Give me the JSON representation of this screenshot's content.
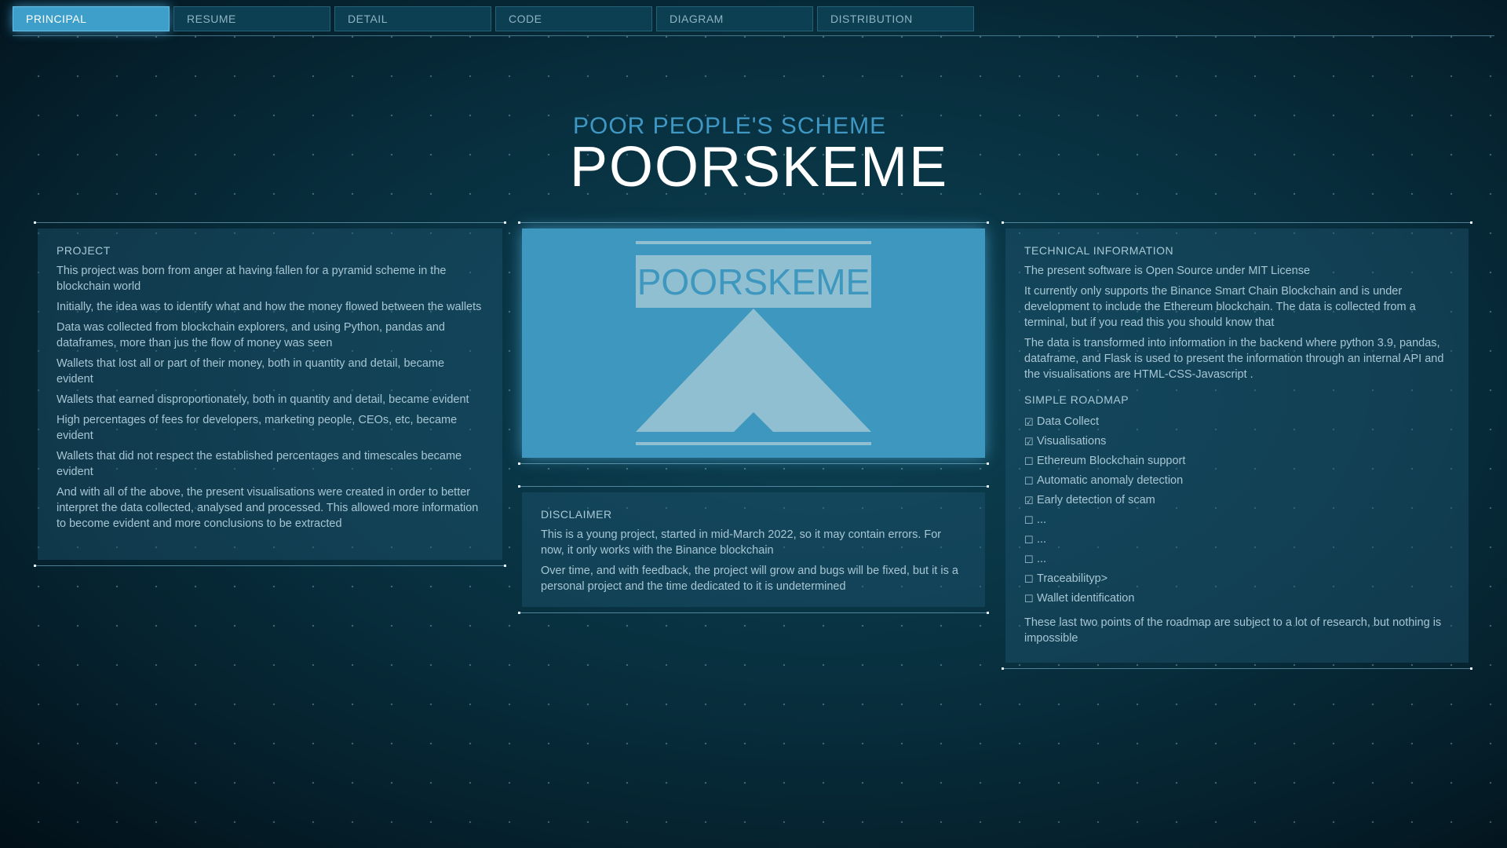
{
  "tabs": [
    {
      "label": "PRINCIPAL",
      "active": true
    },
    {
      "label": "RESUME",
      "active": false
    },
    {
      "label": "DETAIL",
      "active": false
    },
    {
      "label": "CODE",
      "active": false
    },
    {
      "label": "DIAGRAM",
      "active": false
    },
    {
      "label": "DISTRIBUTION",
      "active": false
    }
  ],
  "header": {
    "subtitle": "POOR PEOPLE'S SCHEME",
    "title": "POORSKEME"
  },
  "project": {
    "title": "PROJECT",
    "paragraphs": [
      "This project was born from anger at having fallen for a pyramid scheme in the blockchain world",
      "Initially, the idea was to identify what and how the money flowed between the wallets",
      "Data was collected from blockchain explorers, and using Python, pandas and dataframes, more than jus the flow of money was seen",
      "Wallets that lost all or part of their money, both in quantity and detail, became evident",
      "Wallets that earned disproportionately, both in quantity and detail, became evident",
      "High percentages of fees for developers, marketing people, CEOs, etc, became evident",
      "Wallets that did not respect the established percentages and timescales became evident",
      "And with all of the above, the present visualisations were created in order to better interpret the data collected, analysed and processed. This allowed more information to become evident and more conclusions to be extracted"
    ]
  },
  "logo": {
    "text": "POORSKEME",
    "background": "#3e97be",
    "art_color": "#8fbfd1"
  },
  "disclaimer": {
    "title": "DISCLAIMER",
    "paragraphs": [
      "This is a young project, started in mid-March 2022, so it may contain errors. For now, it only works with the Binance blockchain",
      "Over time, and with feedback, the project will grow and bugs will be fixed, but it is a personal project and the time dedicated to it is undetermined"
    ]
  },
  "technical": {
    "title": "TECHNICAL INFORMATION",
    "paragraphs": [
      "The present software is Open Source under MIT License",
      "It currently only supports the Binance Smart Chain Blockchain and is under development to include the Ethereum blockchain. The data is collected from a terminal, but if you read this you should know that",
      "The data is transformed into information in the backend where python 3.9, pandas, dataframe, and Flask is used to present the information through an internal API and the visualisations are HTML-CSS-Javascript ."
    ],
    "roadmap_title": "SIMPLE ROADMAP",
    "roadmap": [
      {
        "label": "Data Collect",
        "checked": true
      },
      {
        "label": "Visualisations",
        "checked": true
      },
      {
        "label": "Ethereum Blockchain support",
        "checked": false
      },
      {
        "label": "Automatic anomaly detection",
        "checked": false
      },
      {
        "label": "Early detection of scam",
        "checked": true
      },
      {
        "label": "...",
        "checked": false
      },
      {
        "label": "...",
        "checked": false
      },
      {
        "label": "...",
        "checked": false
      },
      {
        "label": "Traceabilityp>",
        "checked": false
      },
      {
        "label": "Wallet identification",
        "checked": false
      }
    ],
    "footer": "These last two points of the roadmap are subject to a lot of research, but nothing is impossible"
  },
  "checkbox_glyphs": {
    "checked": "☑",
    "unchecked": "☐"
  }
}
